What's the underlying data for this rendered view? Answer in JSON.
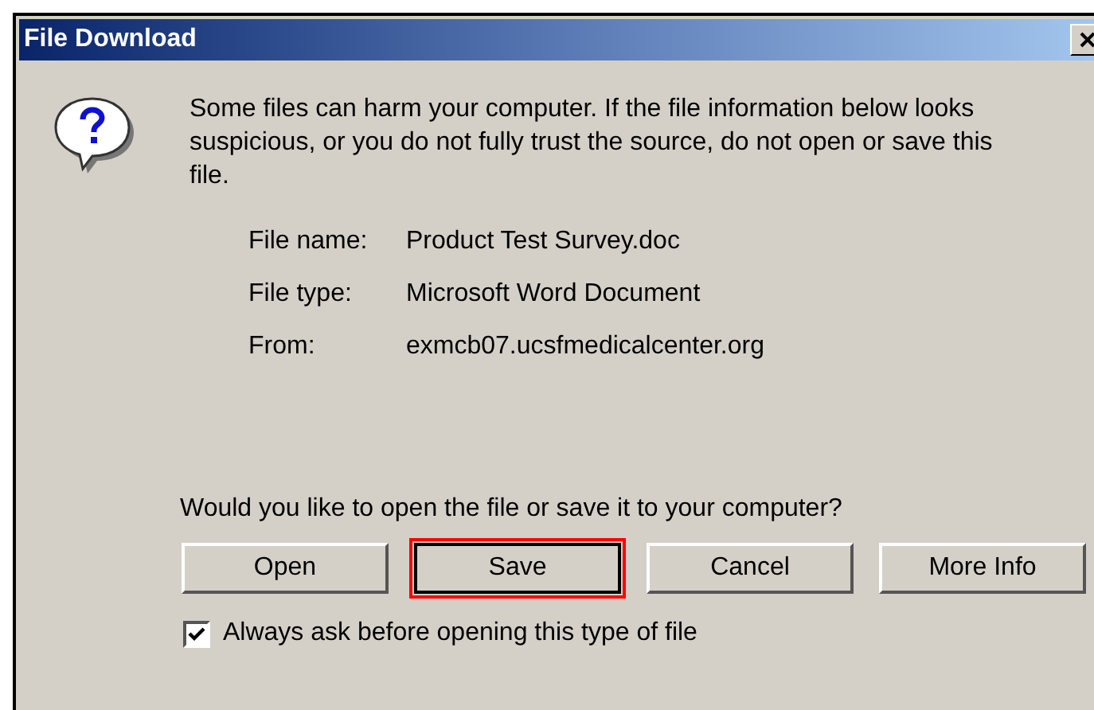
{
  "window": {
    "title": "File Download"
  },
  "message": "Some files can harm your computer. If the file information below looks suspicious, or you do not fully trust the source, do not open or save this file.",
  "details": [
    {
      "label": "File name:",
      "value": "Product Test Survey.doc"
    },
    {
      "label": "File type:",
      "value": "Microsoft Word Document"
    },
    {
      "label": "From:",
      "value": "exmcb07.ucsfmedicalcenter.org"
    }
  ],
  "question": "Would you like to open the file or save it to your computer?",
  "buttons": [
    {
      "label": "Open",
      "selected": false
    },
    {
      "label": "Save",
      "selected": true
    },
    {
      "label": "Cancel",
      "selected": false
    },
    {
      "label": "More Info",
      "selected": false
    }
  ],
  "checkbox": {
    "label": "Always ask before opening this type of file",
    "checked": true
  }
}
